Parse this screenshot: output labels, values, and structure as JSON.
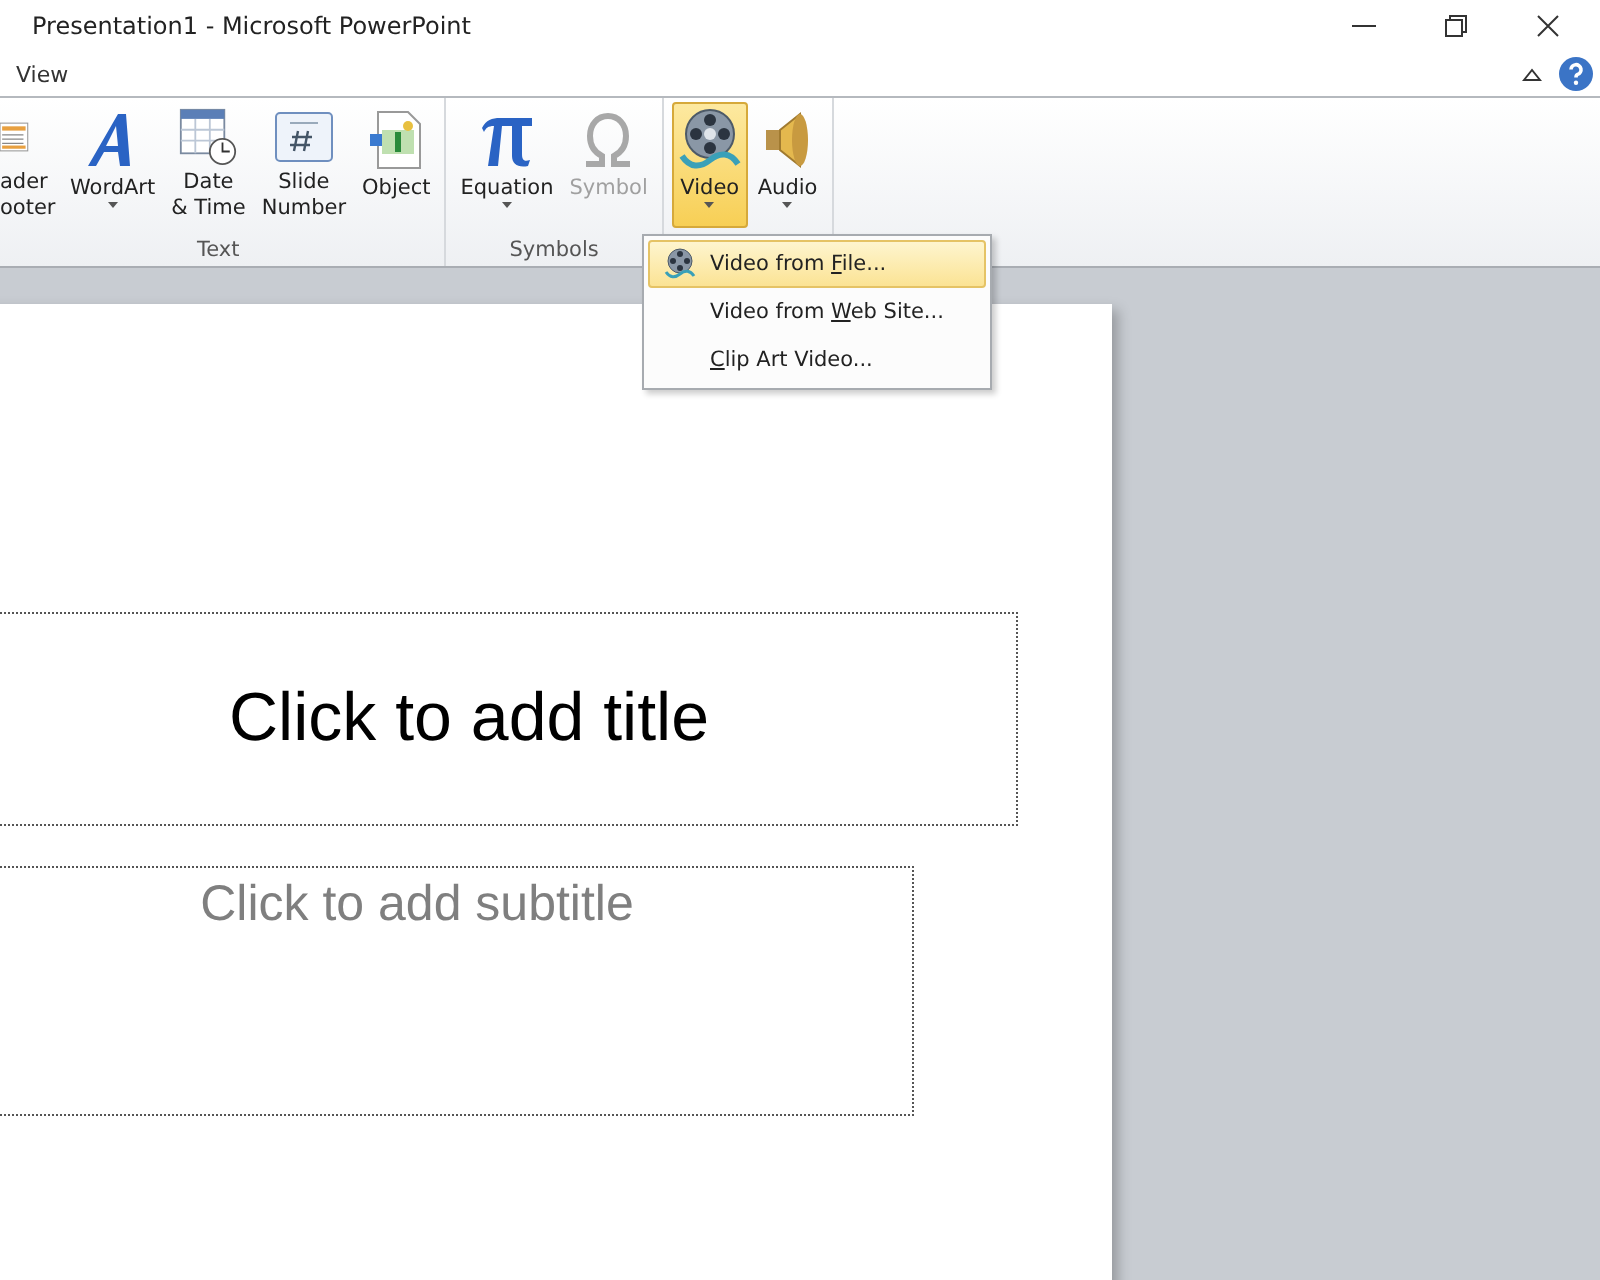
{
  "window": {
    "title": "Presentation1  -  Microsoft PowerPoint"
  },
  "tabs": [
    {
      "label": "View",
      "selected": false
    }
  ],
  "ribbon": {
    "groups": [
      {
        "label": "Text",
        "buttons": [
          {
            "kind": "header",
            "lines": [
              "ader",
              "ooter"
            ],
            "has_menu": false,
            "selected": false,
            "disabled": false
          },
          {
            "kind": "wordart",
            "lines": [
              "WordArt"
            ],
            "has_menu": true,
            "selected": false,
            "disabled": false
          },
          {
            "kind": "date",
            "lines": [
              "Date",
              "& Time"
            ],
            "has_menu": false,
            "selected": false,
            "disabled": false
          },
          {
            "kind": "slidenumber",
            "lines": [
              "Slide",
              "Number"
            ],
            "has_menu": false,
            "selected": false,
            "disabled": false
          },
          {
            "kind": "object",
            "lines": [
              "Object"
            ],
            "has_menu": false,
            "selected": false,
            "disabled": false
          }
        ]
      },
      {
        "label": "Symbols",
        "buttons": [
          {
            "kind": "equation",
            "lines": [
              "Equation"
            ],
            "has_menu": true,
            "selected": false,
            "disabled": false
          },
          {
            "kind": "symbol",
            "lines": [
              "Symbol"
            ],
            "has_menu": false,
            "selected": false,
            "disabled": true
          }
        ]
      },
      {
        "buttons": [
          {
            "kind": "video",
            "lines": [
              "Video"
            ],
            "has_menu": true,
            "selected": true,
            "disabled": false
          },
          {
            "kind": "audio",
            "lines": [
              "Audio"
            ],
            "has_menu": true,
            "selected": false,
            "disabled": false
          }
        ]
      }
    ]
  },
  "video_menu": {
    "items": [
      {
        "before": "Video from ",
        "key": "F",
        "after": "ile...",
        "icon": true,
        "selected": true
      },
      {
        "before": "Video from ",
        "key": "W",
        "after": "eb Site...",
        "icon": false,
        "selected": false
      },
      {
        "key": "C",
        "after": "lip Art Video...",
        "icon": false,
        "selected": false
      }
    ]
  },
  "slide": {
    "title_placeholder": "Click to add title",
    "subtitle_placeholder": "Click to add subtitle"
  }
}
